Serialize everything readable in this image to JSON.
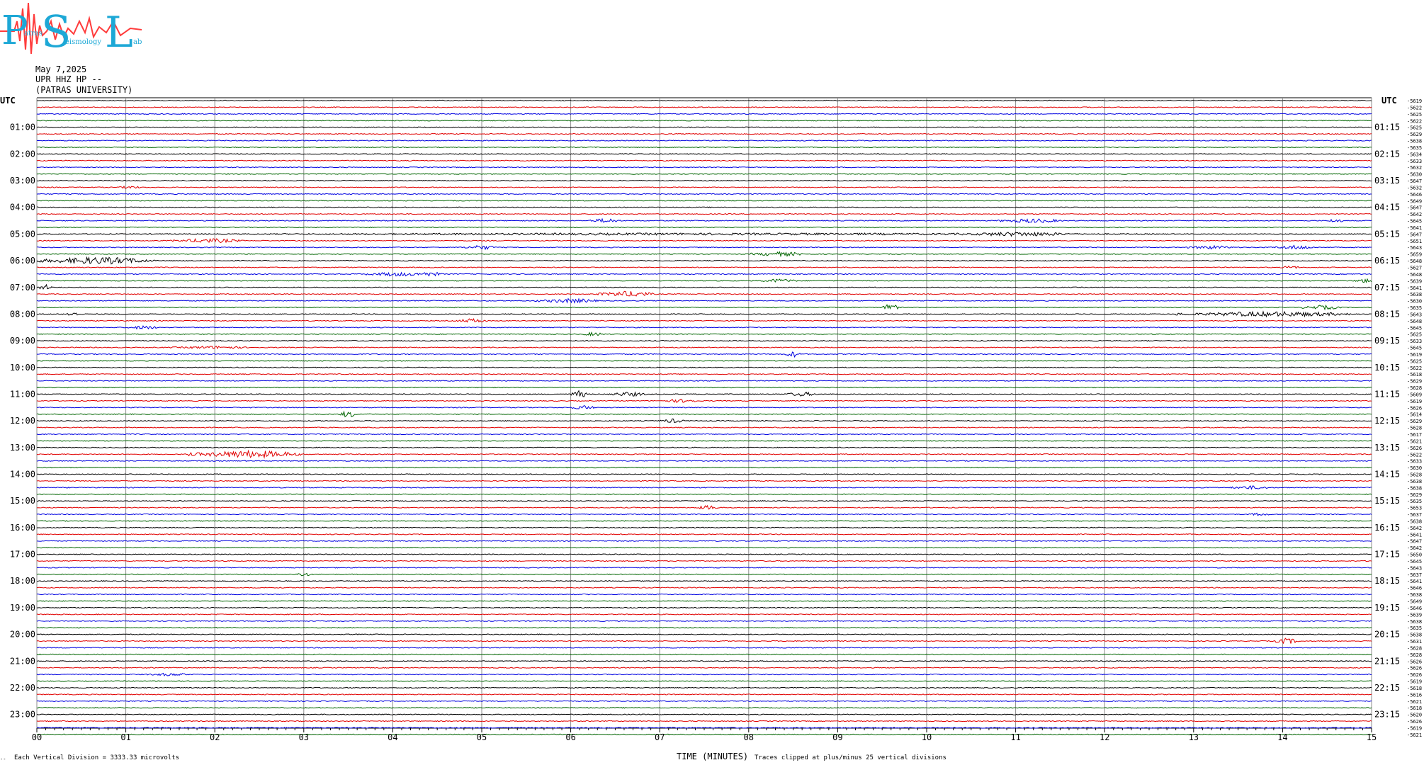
{
  "logo": {
    "letters": [
      "P",
      "S",
      "L"
    ],
    "small_words": [
      "atras",
      "eismology",
      "ab"
    ]
  },
  "header": {
    "date": "May 7,2025",
    "station": "UPR HHZ HP --",
    "institution": "(PATRAS UNIVERSITY)"
  },
  "footer": {
    "left_mark": "-- ",
    "vertical_division": "Each Vertical Division = 3333.33 microvolts",
    "clip_note": "Traces clipped at plus/minus 25 vertical divisions"
  },
  "chart_data": {
    "type": "line",
    "title": "",
    "xlabel": "TIME (MINUTES)",
    "xlim": [
      0,
      15
    ],
    "x_ticks": [
      "00",
      "01",
      "02",
      "03",
      "04",
      "05",
      "06",
      "07",
      "08",
      "09",
      "10",
      "11",
      "12",
      "13",
      "14",
      "15"
    ],
    "left_axis_title": "UTC",
    "right_axis_title": "UTC",
    "left_hour_labels": [
      "01:00",
      "02:00",
      "03:00",
      "04:00",
      "05:00",
      "06:00",
      "07:00",
      "08:00",
      "09:00",
      "10:00",
      "11:00",
      "12:00",
      "13:00",
      "14:00",
      "15:00",
      "16:00",
      "17:00",
      "18:00",
      "19:00",
      "20:00",
      "21:00",
      "22:00",
      "23:00"
    ],
    "right_hour_labels": [
      "01:15",
      "02:15",
      "03:15",
      "04:15",
      "05:15",
      "06:15",
      "07:15",
      "08:15",
      "09:15",
      "10:15",
      "11:15",
      "12:15",
      "13:15",
      "14:15",
      "15:15",
      "16:15",
      "17:15",
      "18:15",
      "19:15",
      "20:15",
      "21:15",
      "22:15",
      "23:15"
    ],
    "trace_minutes": 15,
    "trace_count": 96,
    "trace_colors": [
      "#000000",
      "#e00000",
      "#0000e0",
      "#006400"
    ],
    "trace_offsets": [
      -5619,
      -5622,
      -5625,
      -5622,
      -5625,
      -5629,
      -5638,
      -5635,
      -5634,
      -5633,
      -5632,
      -5630,
      -5647,
      -5632,
      -5646,
      -5649,
      -5647,
      -5642,
      -5645,
      -5641,
      -5647,
      -5651,
      -5643,
      -5659,
      -5648,
      -5627,
      -5648,
      -5639,
      -5641,
      -5638,
      -5630,
      -5635,
      -5643,
      -5648,
      -5645,
      -5625,
      -5633,
      -5645,
      -5619,
      -5625,
      -5622,
      -5618,
      -5629,
      -5628,
      -5609,
      -5619,
      -5626,
      -5614,
      -5629,
      -5628,
      -5617,
      -5621,
      -5626,
      -5622,
      -5633,
      -5630,
      -5628,
      -5638,
      -5638,
      -5629,
      -5635,
      -5653,
      -5637,
      -5638,
      -5642,
      -5641,
      -5647,
      -5642,
      -5650,
      -5645,
      -5643,
      -5637,
      -5641,
      -5646,
      -5638,
      -5649,
      -5646,
      -5639,
      -5638,
      -5635,
      -5638,
      -5631,
      -5628,
      -5628,
      -5626,
      -5626,
      -5626,
      -5619,
      -5618,
      -5616,
      -5621,
      -5618,
      -5620,
      -5626,
      -5619,
      -5621
    ],
    "noise_amplitude": 0.6,
    "events": [
      {
        "trace": 13,
        "minute": 0.9,
        "duration": 0.3,
        "amplitude": 2
      },
      {
        "trace": 18,
        "minute": 6.2,
        "duration": 0.4,
        "amplitude": 3
      },
      {
        "trace": 18,
        "minute": 10.8,
        "duration": 0.8,
        "amplitude": 3
      },
      {
        "trace": 18,
        "minute": 14.5,
        "duration": 0.2,
        "amplitude": 3
      },
      {
        "trace": 20,
        "minute": 10.3,
        "duration": 1.5,
        "amplitude": 3
      },
      {
        "trace": 20,
        "minute": 0.0,
        "duration": 15,
        "amplitude": 1.5
      },
      {
        "trace": 21,
        "minute": 1.5,
        "duration": 0.9,
        "amplitude": 3
      },
      {
        "trace": 22,
        "minute": 4.8,
        "duration": 0.4,
        "amplitude": 3
      },
      {
        "trace": 22,
        "minute": 12.9,
        "duration": 0.6,
        "amplitude": 2.5
      },
      {
        "trace": 22,
        "minute": 13.9,
        "duration": 0.5,
        "amplitude": 3
      },
      {
        "trace": 23,
        "minute": 8.0,
        "duration": 0.7,
        "amplitude": 3
      },
      {
        "trace": 24,
        "minute": 0.0,
        "duration": 1.4,
        "amplitude": 5
      },
      {
        "trace": 25,
        "minute": 14.0,
        "duration": 0.2,
        "amplitude": 3
      },
      {
        "trace": 26,
        "minute": 3.7,
        "duration": 0.7,
        "amplitude": 3
      },
      {
        "trace": 26,
        "minute": 4.2,
        "duration": 0.4,
        "amplitude": 3
      },
      {
        "trace": 27,
        "minute": 8.1,
        "duration": 0.5,
        "amplitude": 2.5
      },
      {
        "trace": 27,
        "minute": 14.8,
        "duration": 0.3,
        "amplitude": 3
      },
      {
        "trace": 28,
        "minute": 0.0,
        "duration": 0.2,
        "amplitude": 4
      },
      {
        "trace": 29,
        "minute": 6.3,
        "duration": 0.7,
        "amplitude": 4
      },
      {
        "trace": 30,
        "minute": 5.6,
        "duration": 0.8,
        "amplitude": 3
      },
      {
        "trace": 31,
        "minute": 9.5,
        "duration": 0.2,
        "amplitude": 5
      },
      {
        "trace": 31,
        "minute": 14.2,
        "duration": 0.5,
        "amplitude": 3
      },
      {
        "trace": 32,
        "minute": 12.8,
        "duration": 2.2,
        "amplitude": 3.5
      },
      {
        "trace": 32,
        "minute": 0.3,
        "duration": 0.2,
        "amplitude": 3
      },
      {
        "trace": 33,
        "minute": 4.7,
        "duration": 0.4,
        "amplitude": 3
      },
      {
        "trace": 34,
        "minute": 1.0,
        "duration": 0.4,
        "amplitude": 2.5
      },
      {
        "trace": 35,
        "minute": 6.1,
        "duration": 0.3,
        "amplitude": 2.5
      },
      {
        "trace": 37,
        "minute": 1.5,
        "duration": 1.0,
        "amplitude": 2
      },
      {
        "trace": 38,
        "minute": 8.4,
        "duration": 0.2,
        "amplitude": 4
      },
      {
        "trace": 44,
        "minute": 6.0,
        "duration": 0.2,
        "amplitude": 5
      },
      {
        "trace": 44,
        "minute": 6.4,
        "duration": 0.5,
        "amplitude": 3
      },
      {
        "trace": 44,
        "minute": 8.4,
        "duration": 0.4,
        "amplitude": 3
      },
      {
        "trace": 45,
        "minute": 7.0,
        "duration": 0.5,
        "amplitude": 2.5
      },
      {
        "trace": 46,
        "minute": 6.0,
        "duration": 0.3,
        "amplitude": 3
      },
      {
        "trace": 47,
        "minute": 3.4,
        "duration": 0.2,
        "amplitude": 5
      },
      {
        "trace": 48,
        "minute": 7.0,
        "duration": 0.3,
        "amplitude": 3
      },
      {
        "trace": 53,
        "minute": 1.7,
        "duration": 1.4,
        "amplitude": 5
      },
      {
        "trace": 58,
        "minute": 13.4,
        "duration": 0.5,
        "amplitude": 2.5
      },
      {
        "trace": 61,
        "minute": 7.4,
        "duration": 0.3,
        "amplitude": 3
      },
      {
        "trace": 62,
        "minute": 13.6,
        "duration": 0.3,
        "amplitude": 2
      },
      {
        "trace": 71,
        "minute": 2.9,
        "duration": 0.2,
        "amplitude": 3
      },
      {
        "trace": 81,
        "minute": 13.9,
        "duration": 0.3,
        "amplitude": 4
      },
      {
        "trace": 86,
        "minute": 1.2,
        "duration": 0.6,
        "amplitude": 2
      }
    ]
  }
}
